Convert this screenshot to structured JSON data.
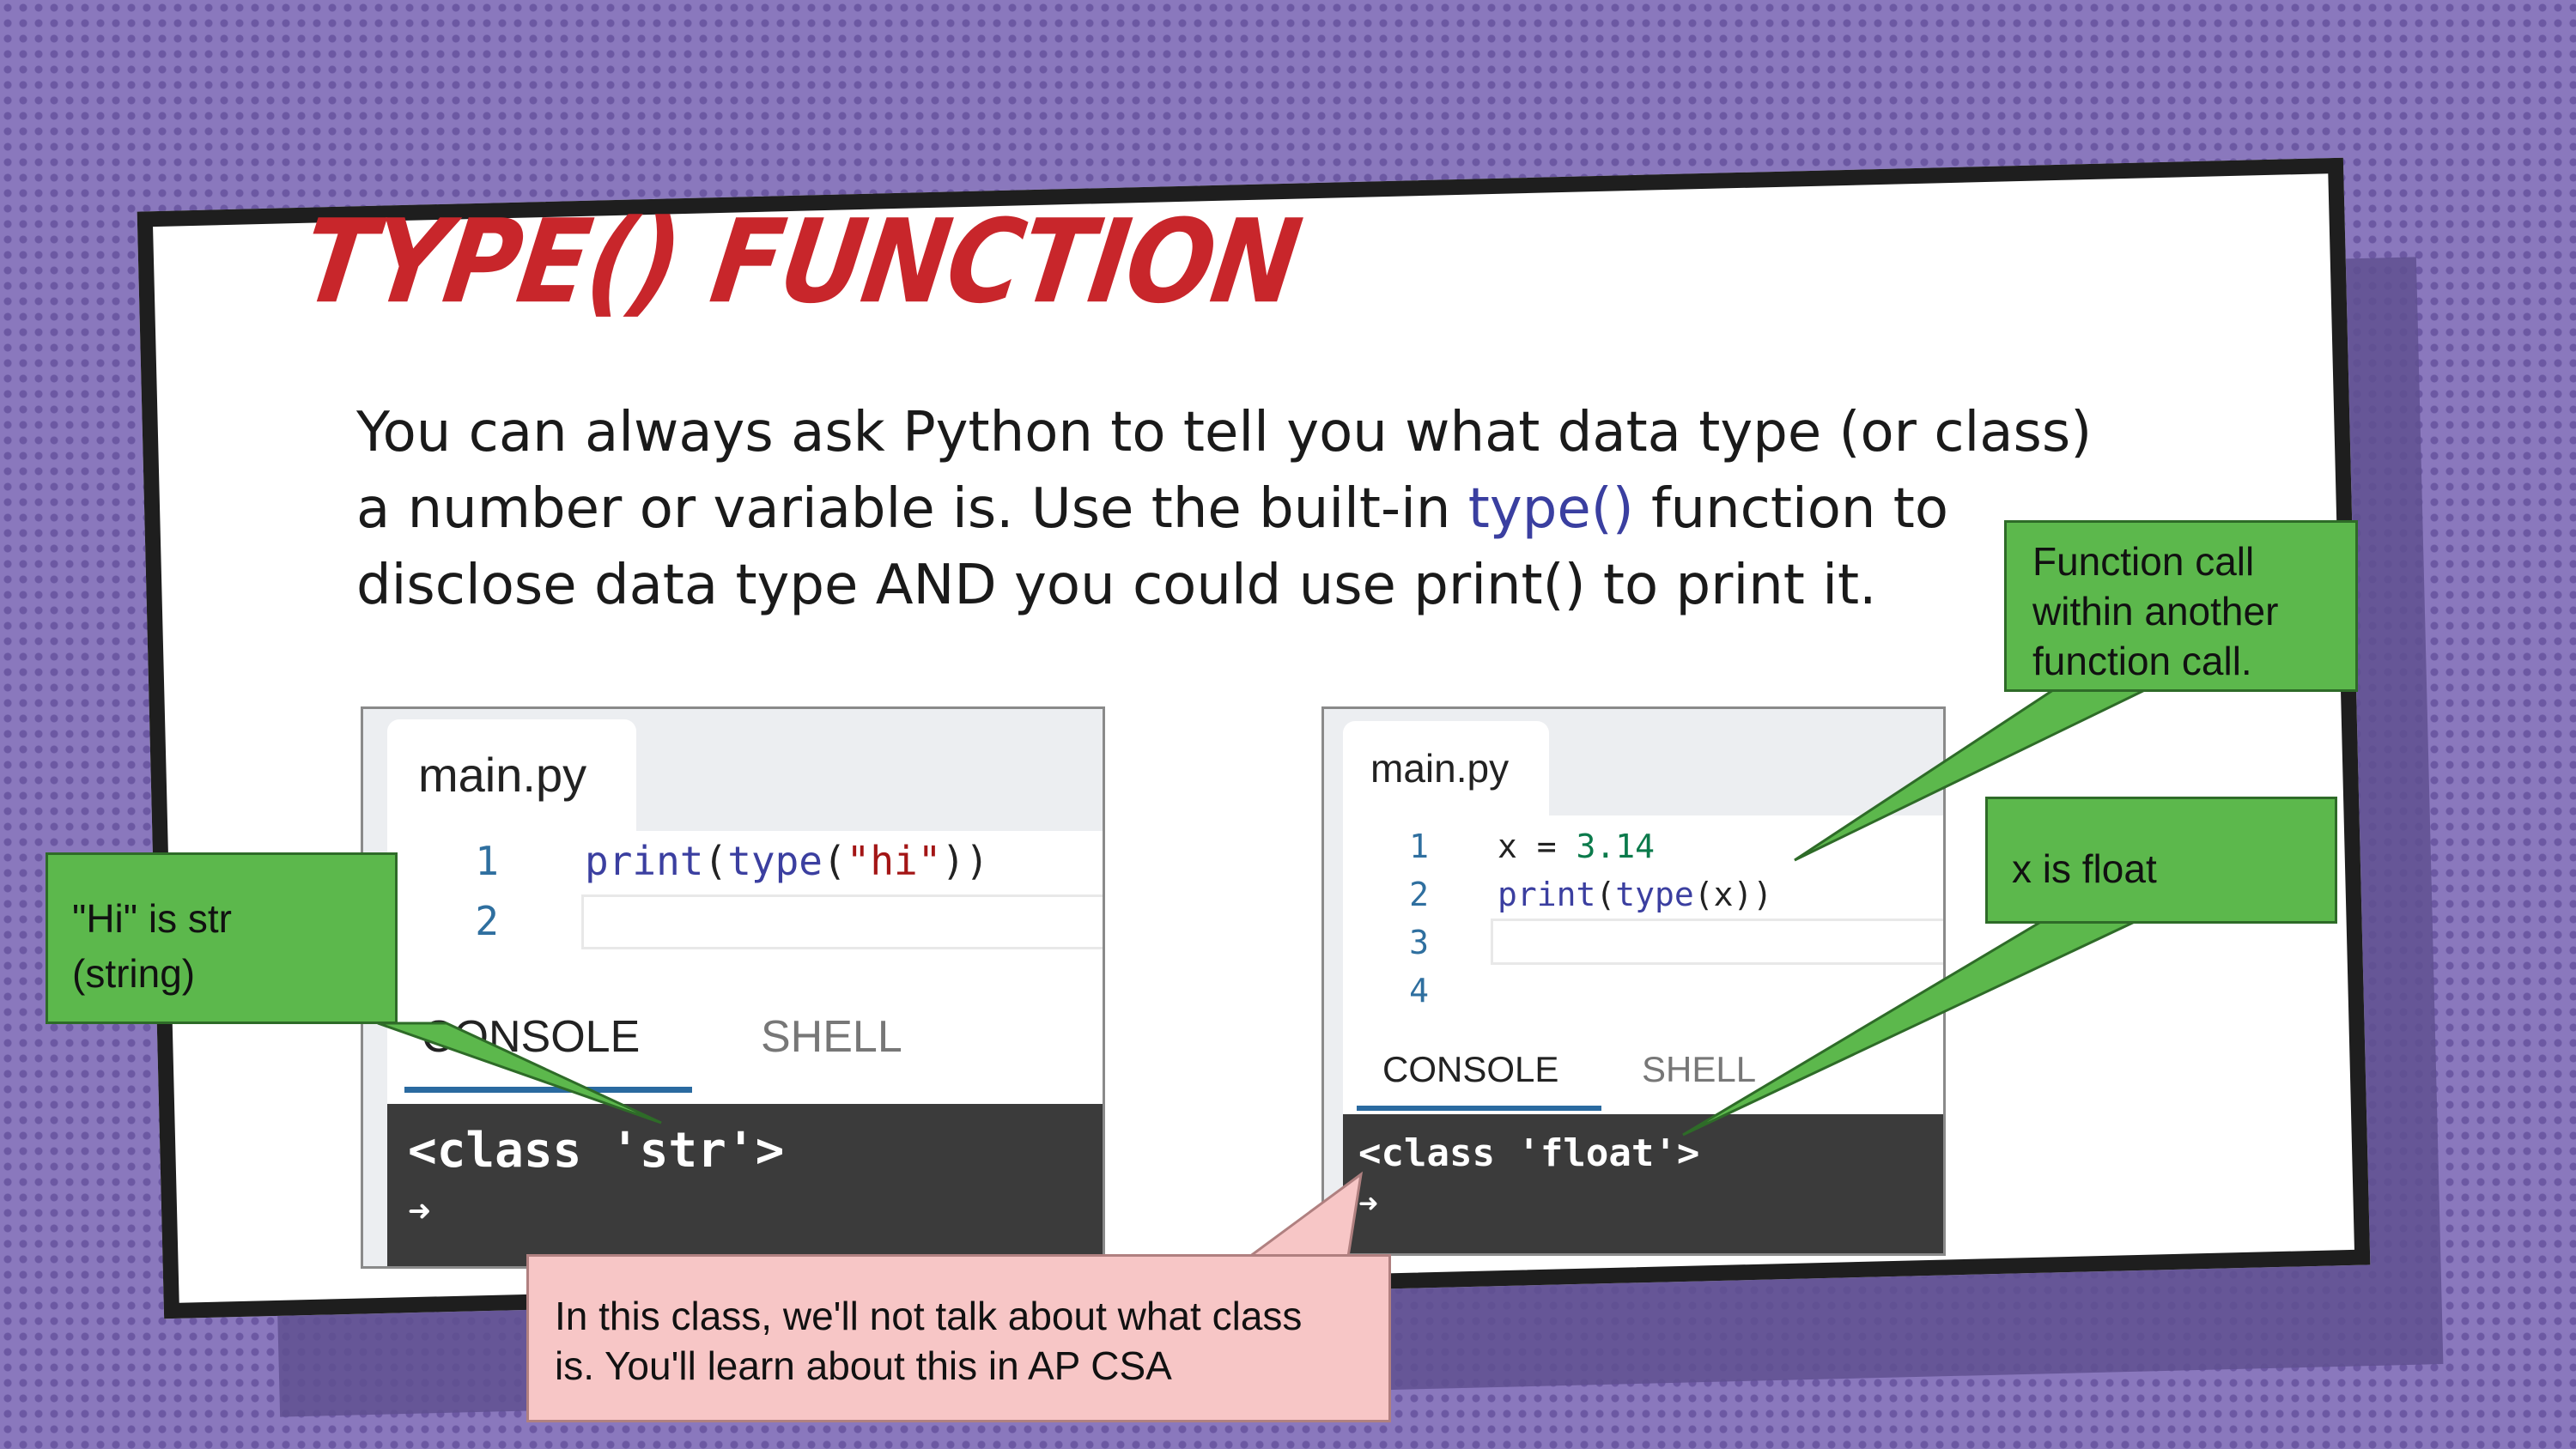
{
  "slide": {
    "title": "TYPE() FUNCTION",
    "intro": {
      "line1": "You can always ask Python to tell you what data type (or class)",
      "line2_before": "a number or variable is. Use the built-in ",
      "line2_keyword": "type()",
      "line2_after": " function to",
      "line3": "disclose data type AND you could use print() to print it."
    }
  },
  "example1": {
    "tab_label": "main.py",
    "code": {
      "line1_no": "1",
      "line1_fn1": "print",
      "line1_p1": "(",
      "line1_fn2": "type",
      "line1_p2": "(",
      "line1_str": "\"hi\"",
      "line1_p3": "))",
      "line2_no": "2"
    },
    "console_tab": "CONSOLE",
    "shell_tab": "SHELL",
    "output": "<class 'str'>",
    "prompt": "➜"
  },
  "example2": {
    "tab_label": "main.py",
    "code": {
      "line1_no": "1",
      "line1_a": "x = ",
      "line1_num": "3.14",
      "line2_no": "2",
      "line2_fn1": "print",
      "line2_p1": "(",
      "line2_fn2": "type",
      "line2_p2": "(x))",
      "line3_no": "3",
      "line4_no": "4"
    },
    "console_tab": "CONSOLE",
    "shell_tab": "SHELL",
    "output": "<class 'float'>",
    "prompt": "➜"
  },
  "callouts": {
    "str_note_line1": "\"Hi\" is str",
    "str_note_line2": "(string)",
    "nested_call_line1": "Function call",
    "nested_call_line2": "within another",
    "nested_call_line3": "function call.",
    "float_note": "x is float",
    "class_note_line1": "In this class, we'll not talk about what class",
    "class_note_line2": "is. You'll learn about this in AP CSA"
  },
  "colors": {
    "background": "#8a78bd",
    "title_red": "#c8262b",
    "keyword_blue": "#3a3fa0",
    "callout_green": "#5cb84c",
    "callout_pink": "#f7c6c6",
    "console_dark": "#3b3b3b",
    "tab_underline": "#2a6aa0"
  }
}
